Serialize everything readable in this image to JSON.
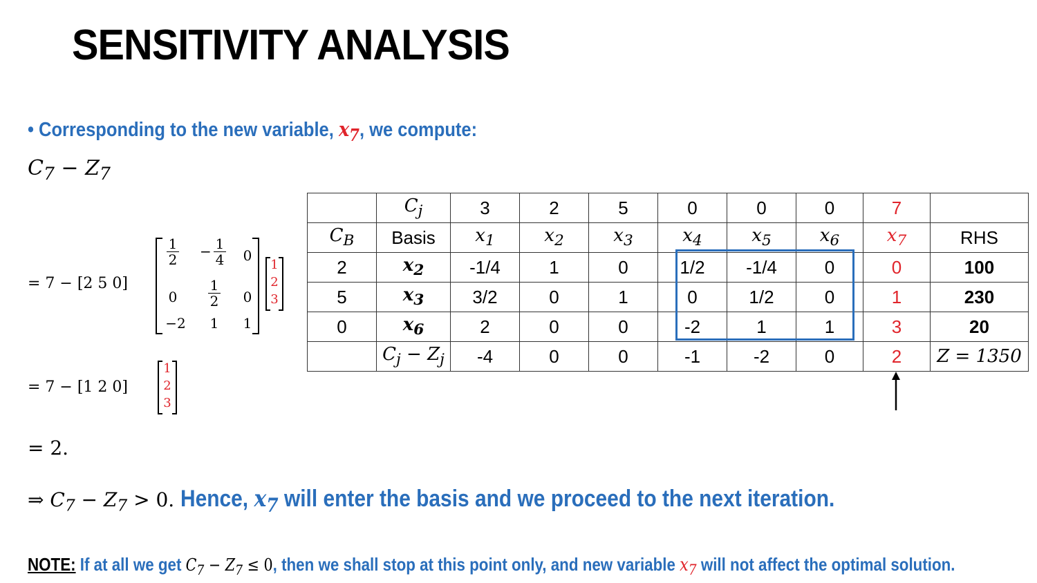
{
  "title": "SENSITIVITY ANALYSIS",
  "bullet": {
    "symbol": "•",
    "text_before": "Corresponding to the new variable,",
    "variable": "x",
    "variable_sub": "7",
    "text_after": ", we compute:"
  },
  "c7z7": {
    "c": "C",
    "c_sub": "7",
    "minus": " − ",
    "z": "Z",
    "z_sub": "7"
  },
  "equation1": {
    "lead": "= 7 − [2   5   0]",
    "matrix": [
      [
        "1/2",
        "−1/4",
        "0"
      ],
      [
        "0",
        "1/2",
        "0"
      ],
      [
        "−2",
        "1",
        "1"
      ]
    ],
    "vector": [
      "1",
      "2",
      "3"
    ]
  },
  "equation2": {
    "lead": "= 7 − [1   2   0]",
    "vector": [
      "1",
      "2",
      "3"
    ]
  },
  "equation3": "= 2.",
  "table": {
    "cj_row": {
      "label": "C",
      "label_sub": "j",
      "values": [
        "3",
        "2",
        "5",
        "0",
        "0",
        "0",
        "7"
      ]
    },
    "header_row": {
      "cb": "C",
      "cb_sub": "B",
      "basis": "Basis",
      "vars": [
        {
          "v": "x",
          "s": "1"
        },
        {
          "v": "x",
          "s": "2"
        },
        {
          "v": "x",
          "s": "3"
        },
        {
          "v": "x",
          "s": "4"
        },
        {
          "v": "x",
          "s": "5"
        },
        {
          "v": "x",
          "s": "6"
        },
        {
          "v": "x",
          "s": "7"
        }
      ],
      "rhs": "RHS"
    },
    "rows": [
      {
        "cb": "2",
        "basis": "x",
        "basis_sub": "2",
        "values": [
          "-1/4",
          "1",
          "0",
          "1/2",
          "-1/4",
          "0",
          "0"
        ],
        "rhs": "100"
      },
      {
        "cb": "5",
        "basis": "x",
        "basis_sub": "3",
        "values": [
          "3/2",
          "0",
          "1",
          "0",
          "1/2",
          "0",
          "1"
        ],
        "rhs": "230"
      },
      {
        "cb": "0",
        "basis": "x",
        "basis_sub": "6",
        "values": [
          "2",
          "0",
          "0",
          "-2",
          "1",
          "1",
          "3"
        ],
        "rhs": "20"
      }
    ],
    "cz_row": {
      "label": "C",
      "label_sub": "j",
      "minus": " − ",
      "label2": "Z",
      "label2_sub": "j",
      "values": [
        "-4",
        "0",
        "0",
        "-1",
        "-2",
        "0",
        "2"
      ],
      "rhs": "Z = 1350"
    }
  },
  "hence": {
    "arrow": "⇒ ",
    "cond_c": "C",
    "cond_c_sub": "7",
    "cond_mid": " − ",
    "cond_z": "Z",
    "cond_z_sub": "7",
    "cond_end": " > 0. ",
    "text1": "Hence, ",
    "var": "x",
    "var_sub": "7",
    "text2": " will enter the basis and we proceed to the next iteration."
  },
  "note": {
    "label": "NOTE:",
    "text1": " If at all we get ",
    "cond": "C",
    "cond_sub": "7",
    "cond_mid": " − ",
    "cond_z": "Z",
    "cond_z_sub": "7",
    "cond_end": " ≤ 0",
    "text2": ", then we shall stop at this point only, and new variable ",
    "var": "x",
    "var_sub": "7",
    "text3": " will not affect the optimal solution."
  },
  "colors": {
    "blue": "#2a6ebb",
    "red": "#e0242b",
    "box": "#2a6ebb"
  }
}
